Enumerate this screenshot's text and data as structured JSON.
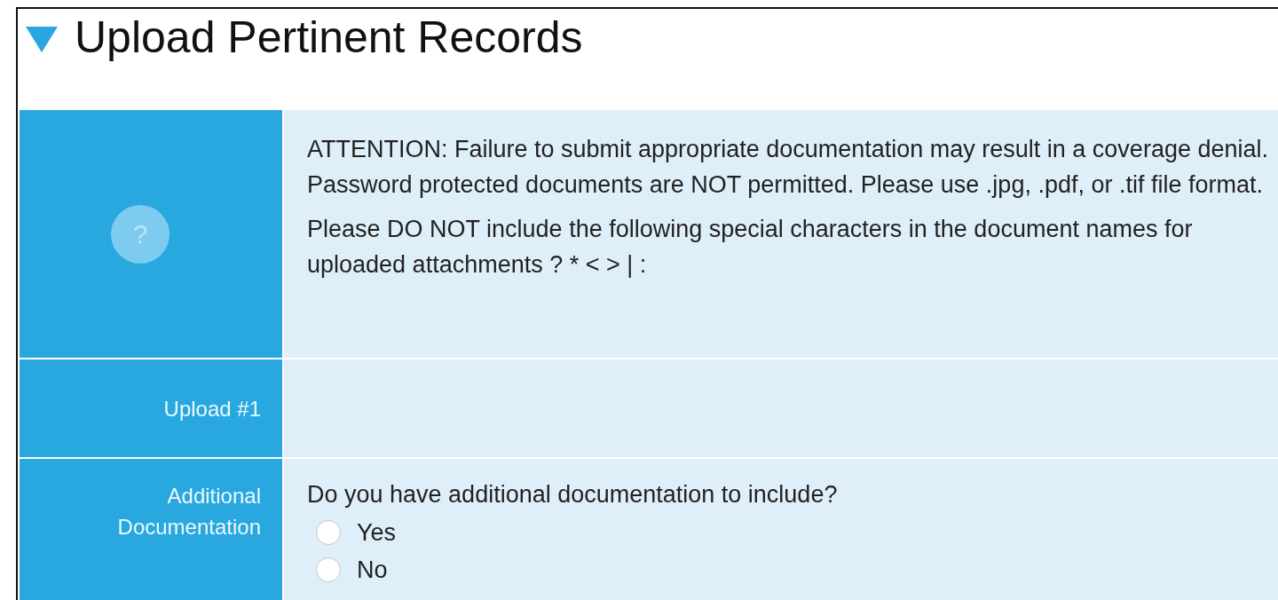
{
  "section": {
    "title": "Upload Pertinent Records",
    "expanded": true
  },
  "rows": [
    {
      "kind": "notice",
      "help_glyph": "?",
      "paragraphs": [
        "ATTENTION: Failure to submit appropriate documentation may result in a coverage denial. Password protected documents are NOT permitted. Please use .jpg, .pdf, or .tif file format.",
        "Please DO NOT include the following special characters in the document names for uploaded attachments ? * < > | :"
      ]
    },
    {
      "kind": "upload",
      "label": "Upload #1"
    },
    {
      "kind": "question",
      "label": "Additional Documentation",
      "question": "Do you have additional documentation to include?",
      "options": [
        {
          "label": "Yes",
          "selected": false
        },
        {
          "label": "No",
          "selected": false
        }
      ]
    }
  ]
}
